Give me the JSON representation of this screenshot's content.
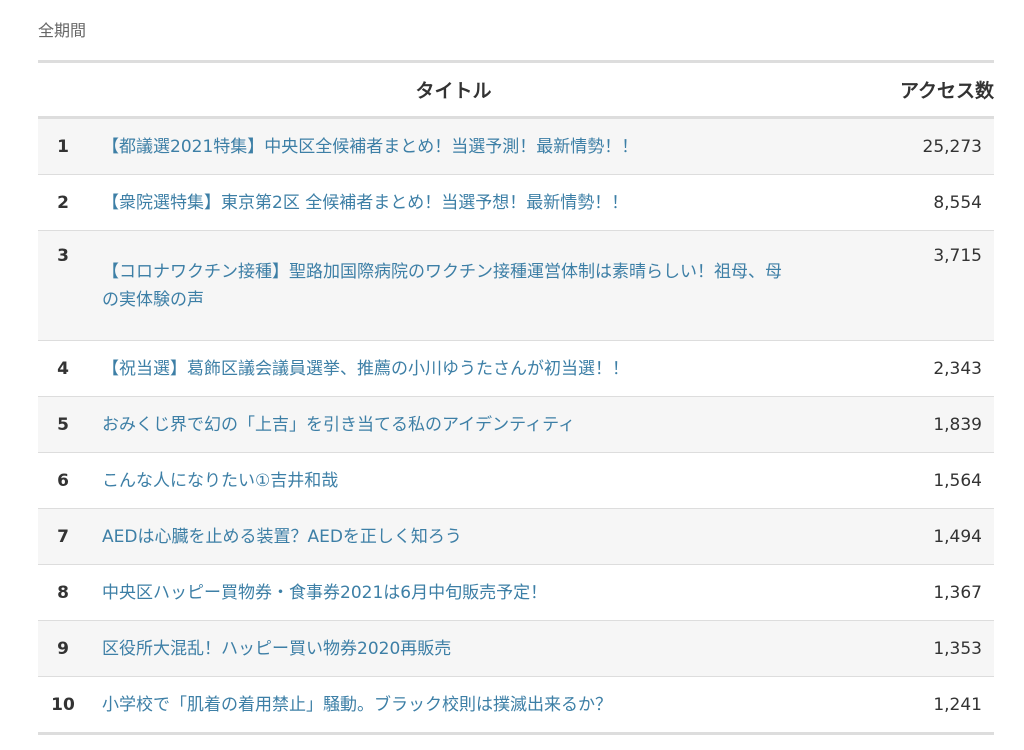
{
  "period_label": "全期間",
  "table": {
    "header": {
      "title": "タイトル",
      "count": "アクセス数"
    },
    "rows": [
      {
        "rank": "1",
        "title": "【都議選2021特集】中央区全候補者まとめ！当選予測！最新情勢！！",
        "count": "25,273"
      },
      {
        "rank": "2",
        "title": "【衆院選特集】東京第2区 全候補者まとめ！当選予想！最新情勢！！",
        "count": "8,554"
      },
      {
        "rank": "3",
        "title": "【コロナワクチン接種】聖路加国際病院のワクチン接種運営体制は素晴らしい！祖母、母の実体験の声",
        "count": "3,715"
      },
      {
        "rank": "4",
        "title": "【祝当選】葛飾区議会議員選挙、推薦の小川ゆうたさんが初当選！！",
        "count": "2,343"
      },
      {
        "rank": "5",
        "title": "おみくじ界で幻の「上吉」を引き当てる私のアイデンティティ",
        "count": "1,839"
      },
      {
        "rank": "6",
        "title": "こんな人になりたい①吉井和哉",
        "count": "1,564"
      },
      {
        "rank": "7",
        "title": "AEDは心臓を止める装置？AEDを正しく知ろう",
        "count": "1,494"
      },
      {
        "rank": "8",
        "title": "中央区ハッピー買物券・食事券2021は6月中旬販売予定！",
        "count": "1,367"
      },
      {
        "rank": "9",
        "title": "区役所大混乱！ハッピー買い物券2020再販売",
        "count": "1,353"
      },
      {
        "rank": "10",
        "title": "小学校で「肌着の着用禁止」騒動。ブラック校則は撲滅出来るか？",
        "count": "1,241"
      }
    ]
  },
  "colors": {
    "link": "#3d7fa6",
    "text": "#333333",
    "muted": "#666666",
    "stripe": "#f6f6f6",
    "border": "#dddddd"
  }
}
